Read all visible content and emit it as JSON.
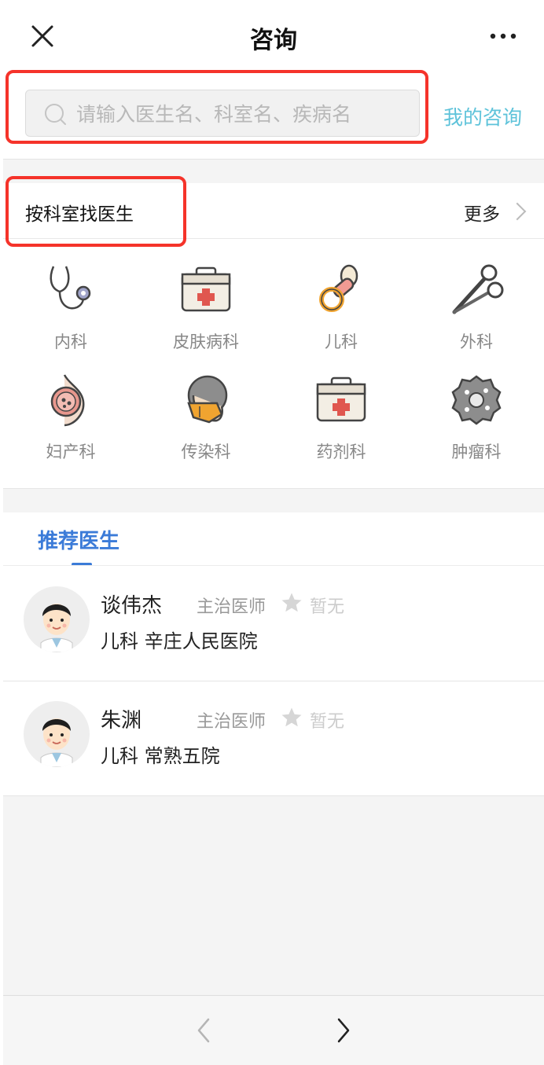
{
  "topbar": {
    "title": "咨询",
    "close_icon": "close-icon",
    "more_icon": "more-dots-icon"
  },
  "search": {
    "placeholder": "请输入医生名、科室名、疾病名",
    "icon": "search-icon",
    "my_consult_label": "我的咨询"
  },
  "department_section": {
    "title": "按科室找医生",
    "more_label": "更多",
    "departments": [
      {
        "label": "内科",
        "icon": "stethoscope-icon"
      },
      {
        "label": "皮肤病科",
        "icon": "medical-kit-icon"
      },
      {
        "label": "儿科",
        "icon": "pacifier-icon"
      },
      {
        "label": "外科",
        "icon": "scissors-icon"
      },
      {
        "label": "妇产科",
        "icon": "pregnancy-icon"
      },
      {
        "label": "传染科",
        "icon": "face-mask-icon"
      },
      {
        "label": "药剂科",
        "icon": "medicine-box-icon"
      },
      {
        "label": "肿瘤科",
        "icon": "tumor-cell-icon"
      }
    ]
  },
  "recommended": {
    "tab_label": "推荐医生",
    "doctors": [
      {
        "name": "谈伟杰",
        "rank": "主治医师",
        "rating": "暂无",
        "dept": "儿科  辛庄人民医院"
      },
      {
        "name": "朱渊",
        "rank": "主治医师",
        "rating": "暂无",
        "dept": "儿科  常熟五院"
      }
    ]
  },
  "bottom_nav": {
    "back_icon": "chevron-left-icon",
    "forward_icon": "chevron-right-icon"
  },
  "colors": {
    "accent_blue": "#3b7bd8",
    "link_cyan": "#5ec3da",
    "highlight_red": "#f5332a"
  }
}
